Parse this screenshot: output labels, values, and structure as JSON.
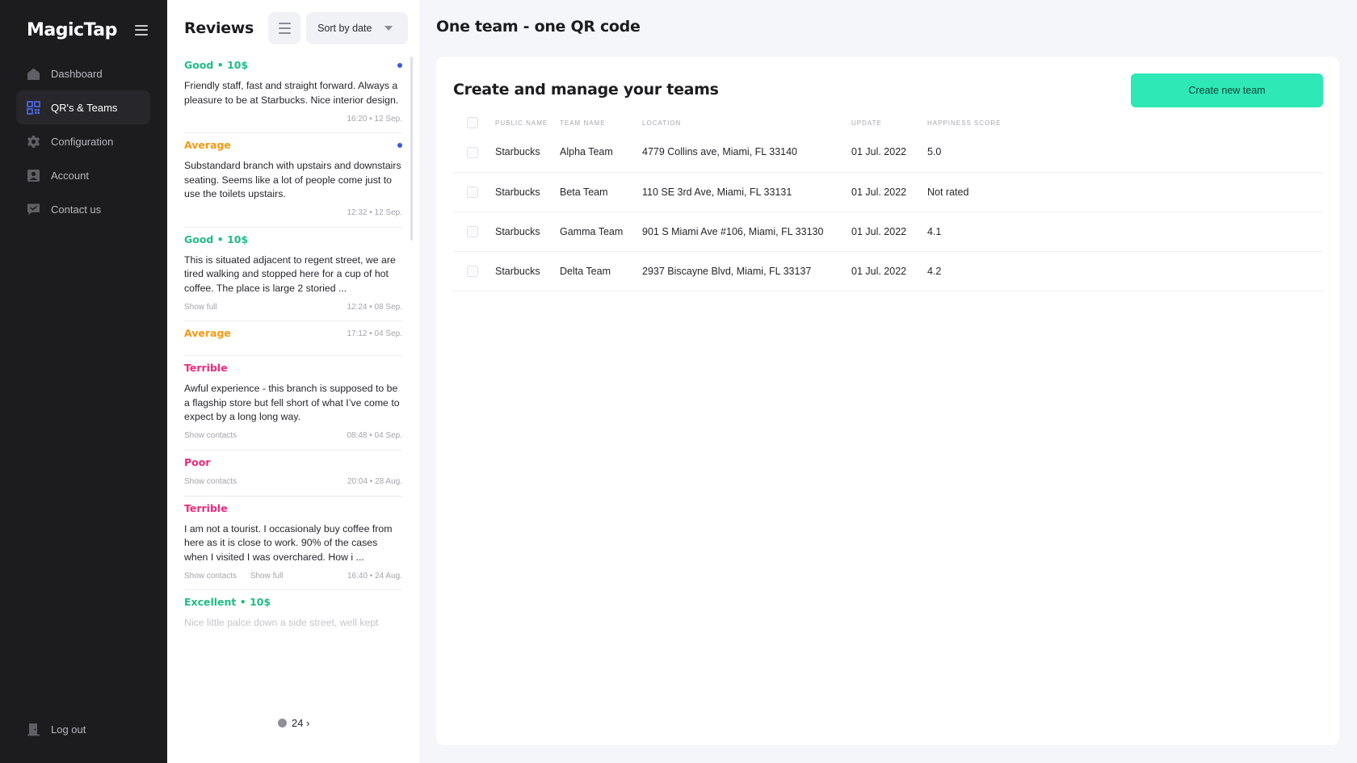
{
  "sidebar": {
    "logo": "MagicTap",
    "nav": [
      {
        "label": "Dashboard",
        "icon": "home-icon",
        "active": false
      },
      {
        "label": "QR's & Teams",
        "icon": "qr-code-icon",
        "active": true
      },
      {
        "label": "Configuration",
        "icon": "gear-icon",
        "active": false
      },
      {
        "label": "Account",
        "icon": "account-icon",
        "active": false
      },
      {
        "label": "Contact us",
        "icon": "chat-icon",
        "active": false
      }
    ],
    "logout": "Log out"
  },
  "reviews": {
    "title": "Reviews",
    "sort_label": "Sort by date",
    "items": [
      {
        "rating": "Good • 10$",
        "level": "good",
        "unread": true,
        "text": "Friendly staff, fast and straight forward. Always a pleasure to be at Starbucks. Nice interior design.",
        "links": [],
        "time": "16:20 • 12 Sep."
      },
      {
        "rating": "Average",
        "level": "avg",
        "unread": true,
        "text": "Substandard branch with upstairs and downstairs seating. Seems like a lot of people come just to use the toilets upstairs.",
        "links": [],
        "time": "12:32 • 12 Sep."
      },
      {
        "rating": "Good • 10$",
        "level": "good",
        "unread": false,
        "text": "This is situated adjacent to regent street, we are tired walking and stopped here for a cup of hot coffee. The place is large 2 storied ...",
        "links": [
          "Show full"
        ],
        "time": "12:24 • 08 Sep."
      },
      {
        "rating": "Average",
        "level": "avg",
        "unread": false,
        "text": "",
        "links": [],
        "time": "17:12 • 04 Sep."
      },
      {
        "rating": "Terrible",
        "level": "bad",
        "unread": false,
        "text": "Awful experience - this branch is supposed to be a flagship store but fell short of what I’ve come to expect by a long long way.",
        "links": [
          "Show contacts"
        ],
        "time": "08:48 • 04 Sep."
      },
      {
        "rating": "Poor",
        "level": "bad",
        "unread": false,
        "text": "",
        "links": [
          "Show contacts"
        ],
        "time": "20:04 • 28 Aug."
      },
      {
        "rating": "Terrible",
        "level": "bad",
        "unread": false,
        "text": "I am not a tourist. I occasionaly buy coffee from here as it is close to work. 90% of the cases when I visited I was overchared. How i ...",
        "links": [
          "Show contacts",
          "Show full"
        ],
        "time": "16:40 • 24 Aug."
      },
      {
        "rating": "Excellent • 10$",
        "level": "good",
        "unread": false,
        "text": "Nice little palce down a side street, well kept",
        "links": [],
        "time": ""
      }
    ],
    "pager": "24 ›"
  },
  "main": {
    "title": "One team - one QR code",
    "card_title": "Create and manage your teams",
    "create_button": "Create new team",
    "columns": [
      "Public name",
      "Team name",
      "Location",
      "Update",
      "Happiness score"
    ],
    "rows": [
      {
        "public_name": "Starbucks",
        "team_name": "Alpha Team",
        "location": "4779 Collins ave, Miami, FL 33140",
        "update": "01 Jul. 2022",
        "score": "5.0"
      },
      {
        "public_name": "Starbucks",
        "team_name": "Beta Team",
        "location": "110 SE 3rd Ave, Miami, FL 33131",
        "update": "01 Jul. 2022",
        "score": "Not rated"
      },
      {
        "public_name": "Starbucks",
        "team_name": "Gamma Team",
        "location": "901 S Miami Ave #106, Miami, FL 33130",
        "update": "01 Jul. 2022",
        "score": "4.1"
      },
      {
        "public_name": "Starbucks",
        "team_name": "Delta Team",
        "location": "2937 Biscayne Blvd, Miami, FL 33137",
        "update": "01 Jul. 2022",
        "score": "4.2"
      }
    ]
  },
  "colors": {
    "sidebar_bg": "#1c1c1e",
    "accent": "#2ee8b6",
    "good": "#1fbd84",
    "average": "#f59a10",
    "bad": "#f0287a",
    "unread_dot": "#3559e8"
  }
}
